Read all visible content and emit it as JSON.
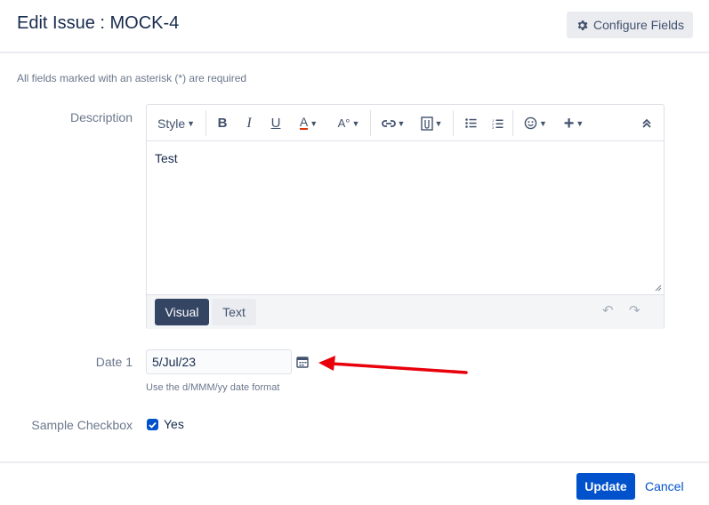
{
  "dialog": {
    "title": "Edit Issue : MOCK-4",
    "configure_label": "Configure Fields",
    "required_note": "All fields marked with an asterisk (*) are required"
  },
  "description": {
    "label": "Description",
    "toolbar": {
      "style_label": "Style",
      "items": [
        "bold-icon",
        "italic-icon",
        "underline-icon",
        "text-color-icon",
        "text-effects-icon",
        "link-icon",
        "attachment-icon",
        "bullet-list-icon",
        "numbered-list-icon",
        "emoji-icon",
        "plus-icon",
        "collapse-icon"
      ]
    },
    "value": "Test",
    "tabs": {
      "visual": "Visual",
      "text": "Text"
    }
  },
  "date1": {
    "label": "Date 1",
    "value": "5/Jul/23",
    "hint": "Use the d/MMM/yy date format"
  },
  "checkbox_field": {
    "label": "Sample Checkbox",
    "option": "Yes",
    "checked": true
  },
  "actions": {
    "update": "Update",
    "cancel": "Cancel"
  },
  "colors": {
    "primary": "#0052cc",
    "annotation_arrow": "#e8000b"
  }
}
